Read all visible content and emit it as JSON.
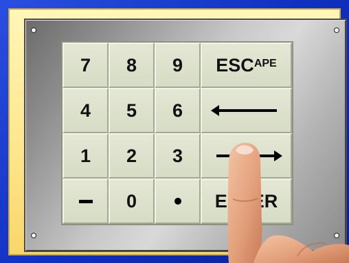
{
  "keypad": {
    "rows": [
      [
        {
          "label": "7",
          "name": "key-7"
        },
        {
          "label": "8",
          "name": "key-8"
        },
        {
          "label": "9",
          "name": "key-9"
        },
        {
          "label_main": "ESC",
          "label_small": "APE",
          "name": "key-escape"
        }
      ],
      [
        {
          "label": "4",
          "name": "key-4"
        },
        {
          "label": "5",
          "name": "key-5"
        },
        {
          "label": "6",
          "name": "key-6"
        },
        {
          "icon": "left-arrow-icon",
          "name": "key-backspace"
        }
      ],
      [
        {
          "label": "1",
          "name": "key-1"
        },
        {
          "label": "2",
          "name": "key-2"
        },
        {
          "label": "3",
          "name": "key-3"
        },
        {
          "icon": "right-arrow-icon",
          "name": "key-forward"
        }
      ],
      [
        {
          "icon": "minus-icon",
          "name": "key-minus"
        },
        {
          "label": "0",
          "name": "key-0"
        },
        {
          "icon": "decimal-point-icon",
          "name": "key-decimal"
        },
        {
          "label": "ENTER",
          "name": "key-enter"
        }
      ]
    ]
  },
  "colors": {
    "outer_frame": "#1433c8",
    "inner_frame": "#fde58a",
    "key_face": "#dde1cc",
    "key_text": "#111111"
  },
  "decor": {
    "screws": [
      "screw-icon",
      "screw-icon",
      "screw-icon",
      "screw-icon"
    ],
    "finger": "pointing-finger-icon"
  }
}
